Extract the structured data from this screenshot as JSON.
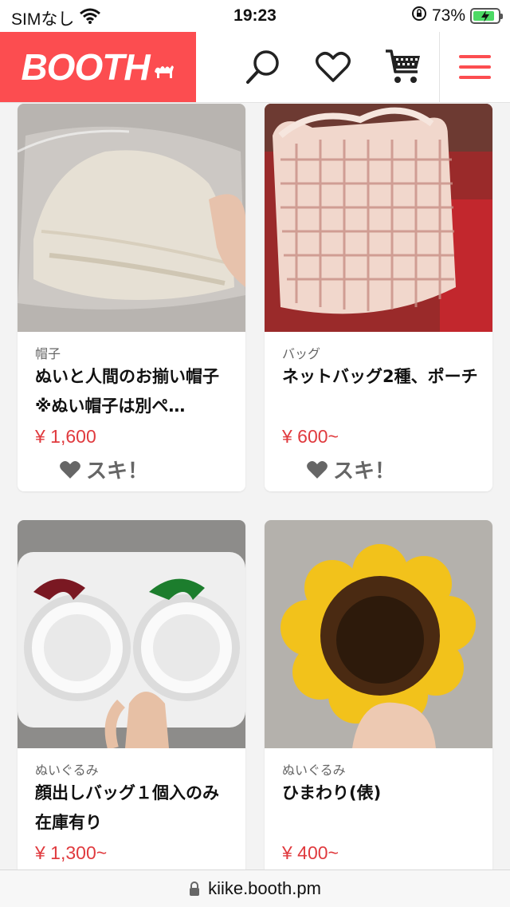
{
  "status": {
    "carrier": "SIMなし",
    "time": "19:23",
    "battery": "73%"
  },
  "header": {
    "logo": "BOOTH"
  },
  "items": [
    {
      "category": "帽子",
      "title": "ぬいと人間のお揃い帽子 ※ぬい帽子は別ペ…",
      "price": "¥ 1,600",
      "like_label": "スキ！"
    },
    {
      "category": "バッグ",
      "title": "ネットバッグ2種、ポーチ",
      "price": "¥ 600~",
      "like_label": "スキ！"
    },
    {
      "category": "ぬいぐるみ",
      "title": "顔出しバッグ１個入のみ在庫有り",
      "price": "¥ 1,300~"
    },
    {
      "category": "ぬいぐるみ",
      "title": "ひまわり(俵)",
      "price": "¥ 400~"
    }
  ],
  "urlbar": {
    "url": "kiike.booth.pm"
  },
  "colors": {
    "brand": "#fc4d50",
    "price": "#e03a3e"
  }
}
